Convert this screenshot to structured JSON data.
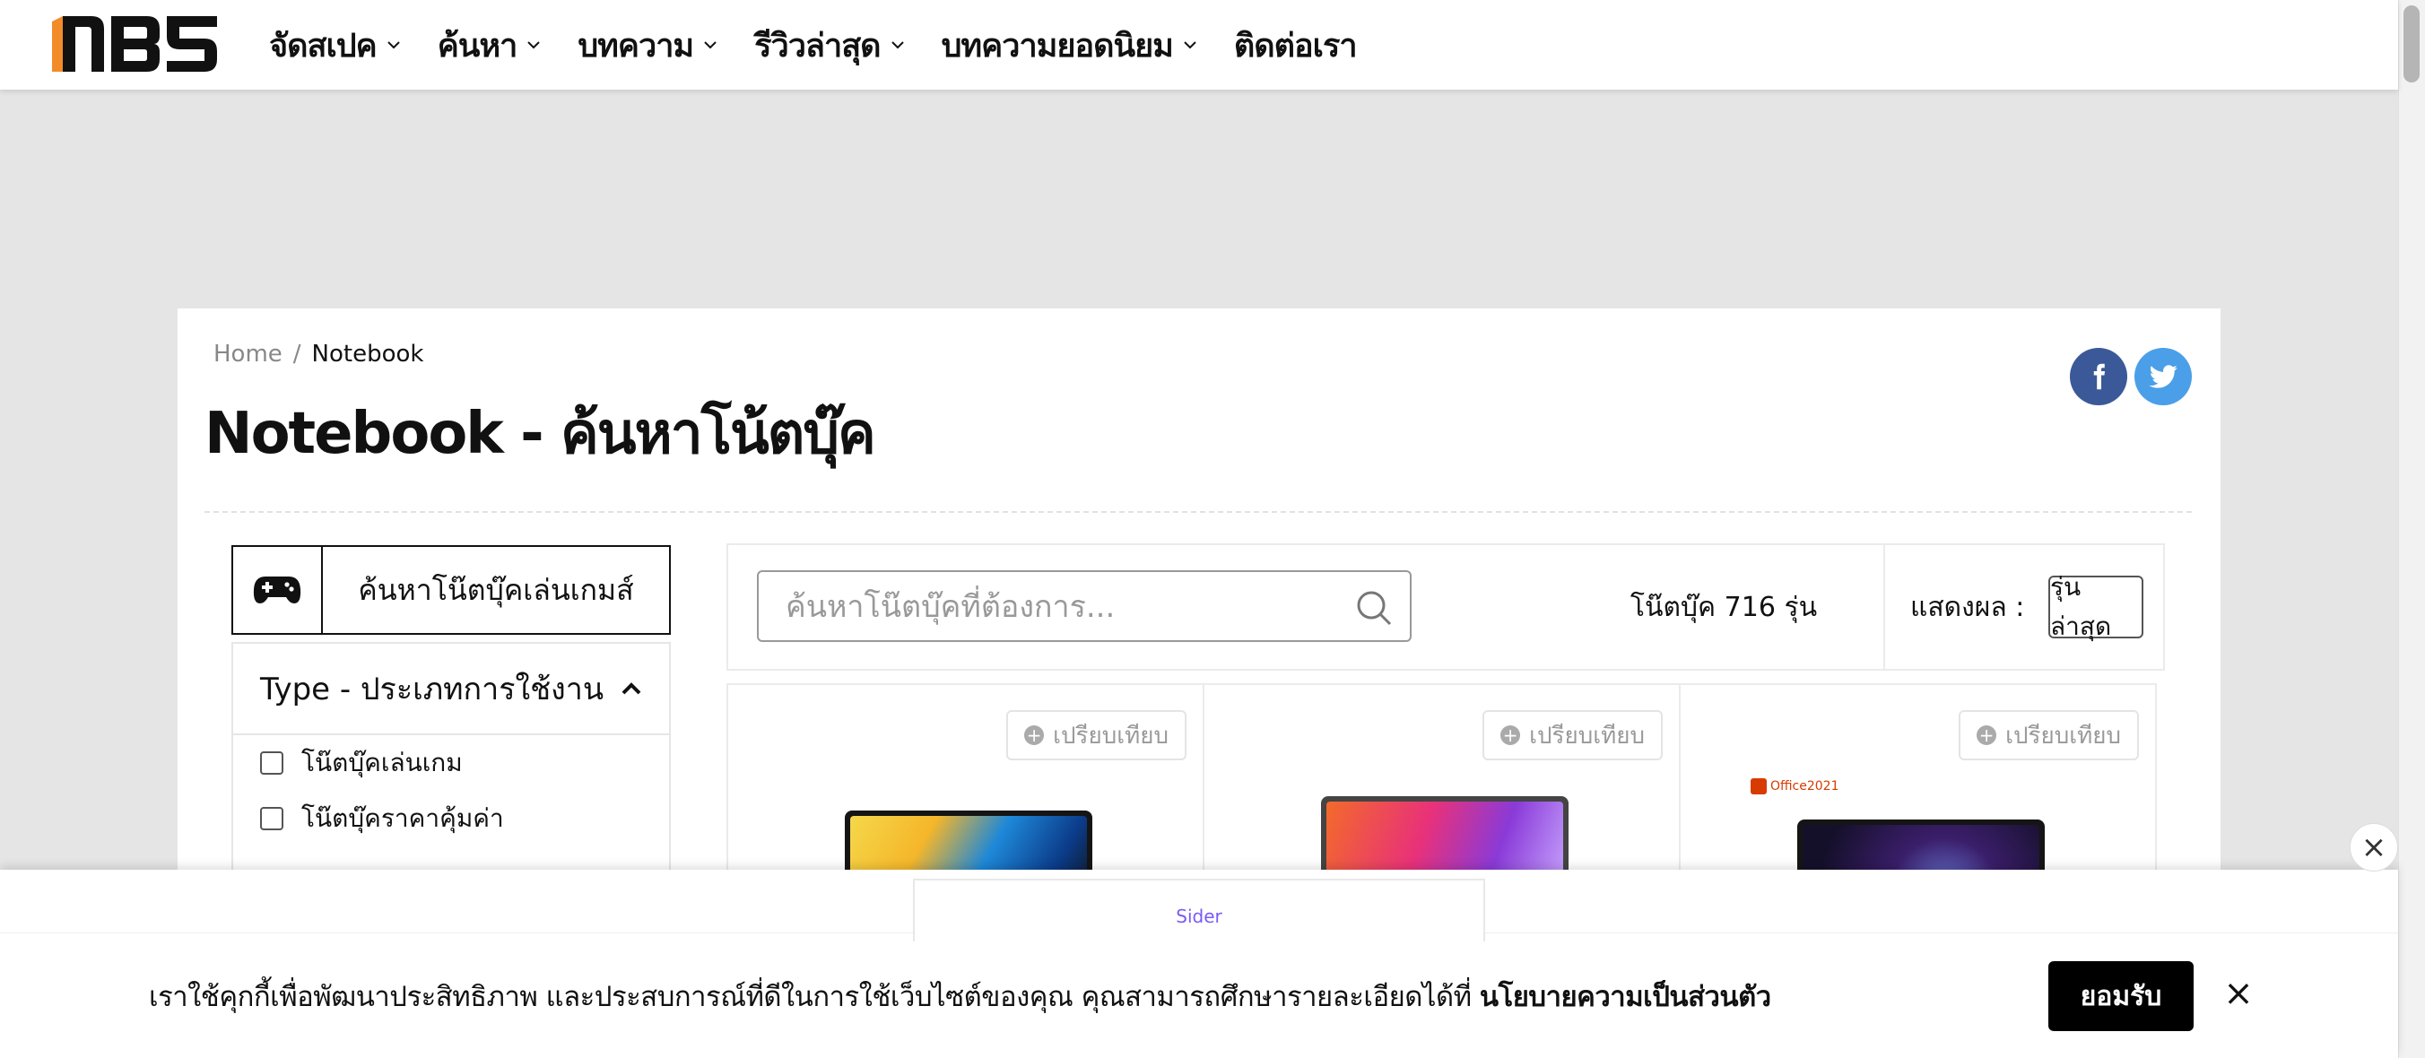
{
  "header": {
    "logo_text": "NBS",
    "nav": [
      {
        "label": "จัดสเปค",
        "has_dropdown": true
      },
      {
        "label": "ค้นหา",
        "has_dropdown": true
      },
      {
        "label": "บทความ",
        "has_dropdown": true
      },
      {
        "label": "รีวิวล่าสุด",
        "has_dropdown": true
      },
      {
        "label": "บทความยอดนิยม",
        "has_dropdown": true
      },
      {
        "label": "ติดต่อเรา",
        "has_dropdown": false
      }
    ]
  },
  "breadcrumb": {
    "home": "Home",
    "separator": "/",
    "current": "Notebook"
  },
  "page": {
    "title": "Notebook - ค้นหาโน้ตบุ๊ค"
  },
  "social": {
    "icons": [
      "facebook-icon",
      "twitter-icon"
    ],
    "facebook_color": "#3b5998",
    "twitter_color": "#4a9fe8"
  },
  "sidebar": {
    "gaming_button_label": "ค้นหาโน๊ตบุ๊คเล่นเกมส์",
    "filter_title": "Type - ประเภทการใช้งาน",
    "filter_options": [
      "โน๊ตบุ๊คเล่นเกม",
      "โน๊ตบุ๊คราคาคุ้มค่า"
    ]
  },
  "toolbar": {
    "search_placeholder": "ค้นหาโน๊ตบุ๊คที่ต้องการ...",
    "count_label": "โน๊ตบุ๊ค 716 รุ่น",
    "sort_label": "แสดงผล :",
    "sort_value": "รุ่นล่าสุด"
  },
  "products": [
    {
      "compare_label": "เปรียบเทียบ"
    },
    {
      "compare_label": "เปรียบเทียบ"
    },
    {
      "compare_label": "เปรียบเทียบ",
      "badge": "Office2021"
    }
  ],
  "cookie": {
    "sider_label": "Sider",
    "text": "เราใช้คุกกี้เพื่อพัฒนาประสิทธิภาพ และประสบการณ์ที่ดีในการใช้เว็บไซต์ของคุณ คุณสามารถศึกษารายละเอียดได้ที่",
    "link_text": "นโยบายความเป็นส่วนตัว",
    "accept_label": "ยอมรับ",
    "close_symbol": "×"
  },
  "colors": {
    "brand_accent": "#f28c28",
    "primary": "#000000"
  }
}
